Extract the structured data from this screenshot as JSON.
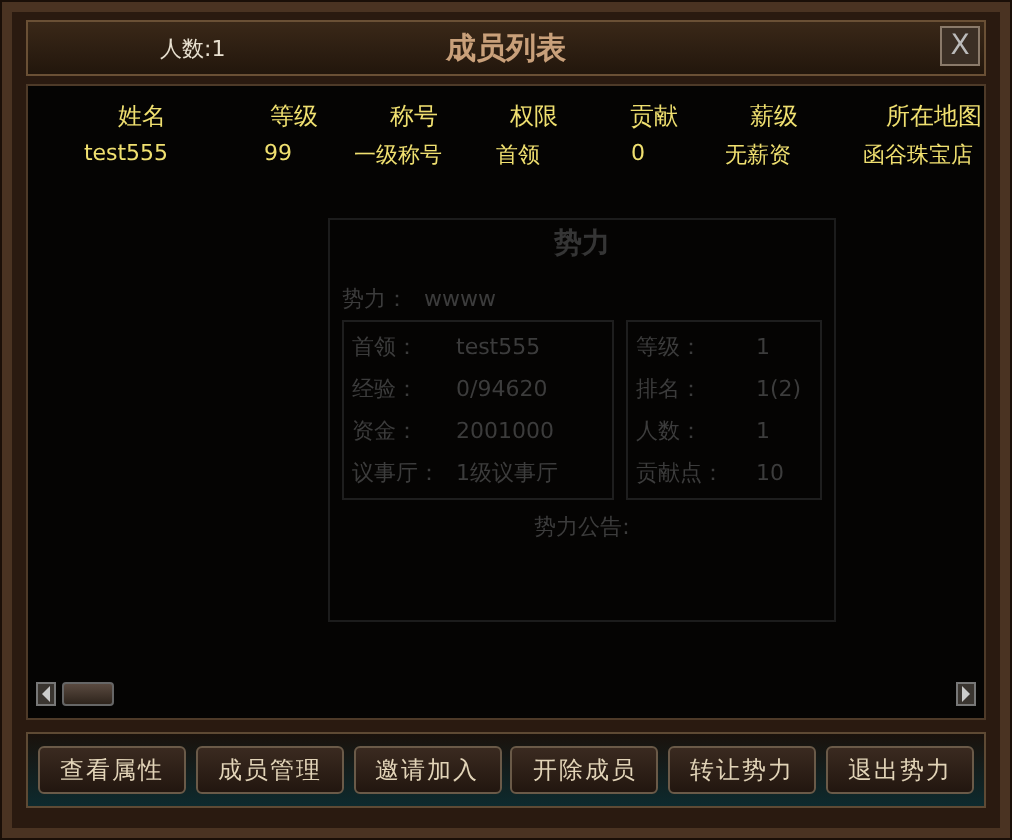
{
  "window": {
    "title": "成员列表",
    "member_count": "人数:1",
    "close": "X"
  },
  "table": {
    "columns": [
      "姓名",
      "等级",
      "称号",
      "权限",
      "贡献",
      "薪级",
      "所在地图"
    ],
    "rows": [
      {
        "cells": [
          "test555",
          "99",
          "一级称号",
          "首领",
          "0",
          "无薪资",
          "函谷珠宝店"
        ],
        "selected": false
      }
    ]
  },
  "background_window": {
    "title": "势力",
    "name_label": "势力：",
    "name_value": "wwww",
    "left_fields": [
      {
        "label": "首领：",
        "value": "test555"
      },
      {
        "label": "经验：",
        "value": "0/94620"
      },
      {
        "label": "资金：",
        "value": "2001000"
      },
      {
        "label": "议事厅：",
        "value": "1级议事厅"
      }
    ],
    "right_fields": [
      {
        "label": "等级：",
        "value": "1"
      },
      {
        "label": "排名：",
        "value": "1(2)"
      },
      {
        "label": "人数：",
        "value": "1"
      },
      {
        "label": "贡献点：",
        "value": "10"
      }
    ],
    "notice_label": "势力公告:"
  },
  "buttons": [
    "查看属性",
    "成员管理",
    "邀请加入",
    "开除成员",
    "转让势力",
    "退出势力"
  ]
}
